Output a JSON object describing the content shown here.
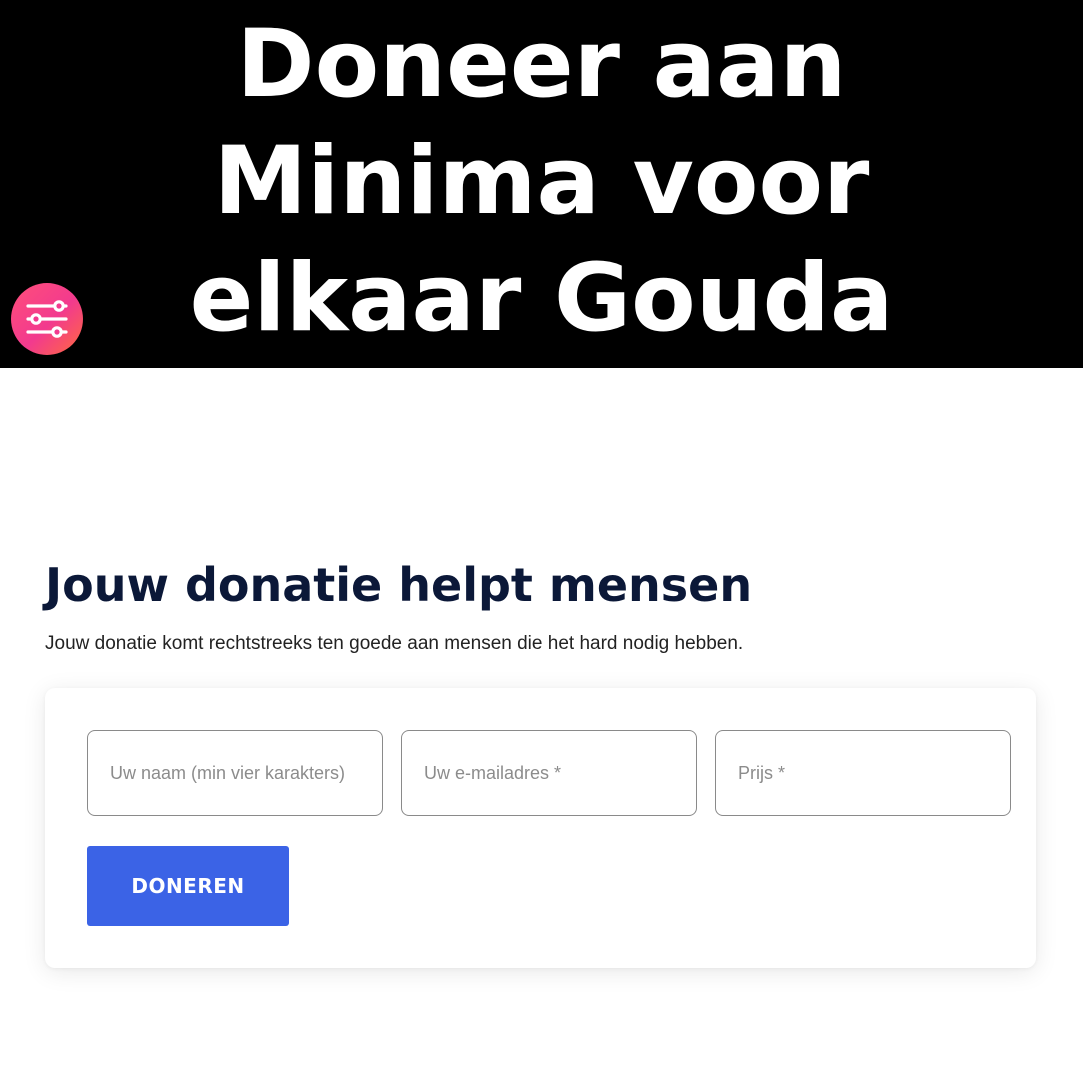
{
  "hero": {
    "title_lines": [
      "Doneer aan",
      "Minima voor",
      "elkaar Gouda"
    ]
  },
  "filter_button": {
    "icon": "sliders-icon",
    "colors": [
      "#ff4f7a",
      "#f23a8e",
      "#ff6a3d"
    ]
  },
  "donation": {
    "heading": "Jouw donatie helpt mensen",
    "subtext": "Jouw donatie komt rechtstreeks ten goede aan mensen die het hard nodig hebben.",
    "form": {
      "name": {
        "value": "",
        "placeholder": "Uw naam (min vier karakters)"
      },
      "email": {
        "value": "",
        "placeholder": "Uw e-mailadres *"
      },
      "price": {
        "value": "",
        "placeholder": "Prijs *"
      },
      "submit_label": "DONEREN"
    }
  },
  "colors": {
    "hero_bg": "#000000",
    "heading": "#0b1838",
    "button": "#3b63e6"
  }
}
